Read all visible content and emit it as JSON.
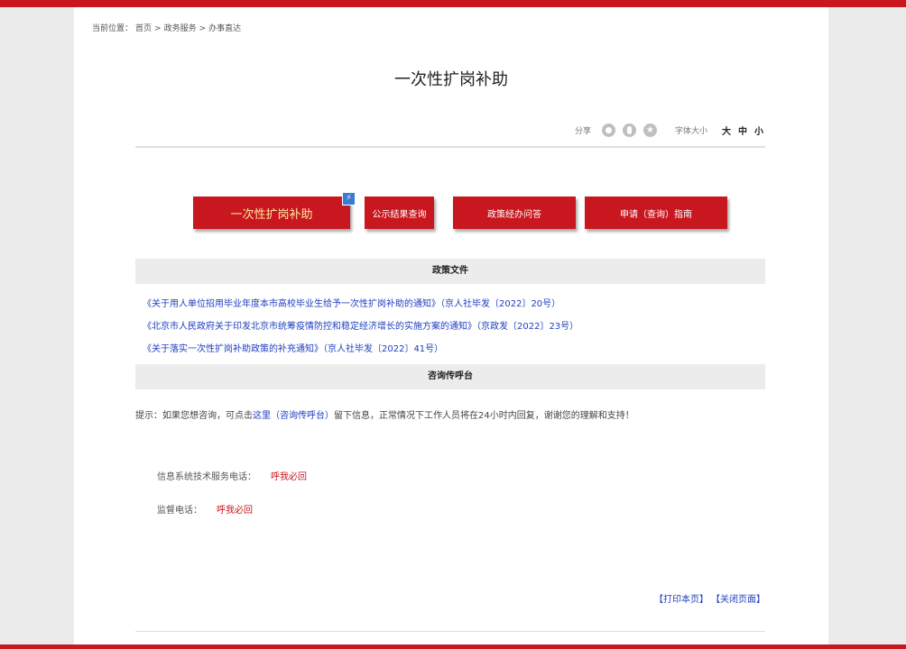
{
  "breadcrumb": {
    "prefix": "当前位置：",
    "items": [
      "首页",
      ">",
      "政务服务",
      ">",
      "办事直达"
    ]
  },
  "title": "一次性扩岗补助",
  "toolbar": {
    "share_label": "分享",
    "font_size_label": "字体大小",
    "large": "大",
    "medium": "中",
    "small": "小"
  },
  "buttons": {
    "main": "一次性扩岗补助",
    "result": "公示结果查询",
    "qa": "政策经办问答",
    "guide": "申请（查询）指南",
    "badge": "⚡"
  },
  "sections": {
    "policy": "政策文件",
    "consult": "咨询传呼台"
  },
  "policy_docs": [
    "《关于用人单位招用毕业年度本市高校毕业生给予一次性扩岗补助的通知》（京人社毕发〔2022〕20号）",
    "《北京市人民政府关于印发北京市统筹疫情防控和稳定经济增长的实施方案的通知》（京政发〔2022〕23号）",
    "《关于落实一次性扩岗补助政策的补充通知》（京人社毕发〔2022〕41号）"
  ],
  "tip": {
    "before": "提示：如果您想咨询，可点击",
    "link": "这里（咨询传呼台）",
    "after": "留下信息，正常情况下工作人员将在24小时内回复，谢谢您的理解和支持！"
  },
  "contacts": [
    {
      "label": "信息系统技术服务电话：",
      "value": "呼我必回"
    },
    {
      "label": "监督电话：",
      "value": "呼我必回"
    }
  ],
  "footer": {
    "print": "【打印本页】",
    "close": "【关闭页面】"
  },
  "colors": {
    "brand_red": "#c8171f",
    "link_blue": "#1f3fbf",
    "badge_blue": "#3b7bd4"
  }
}
